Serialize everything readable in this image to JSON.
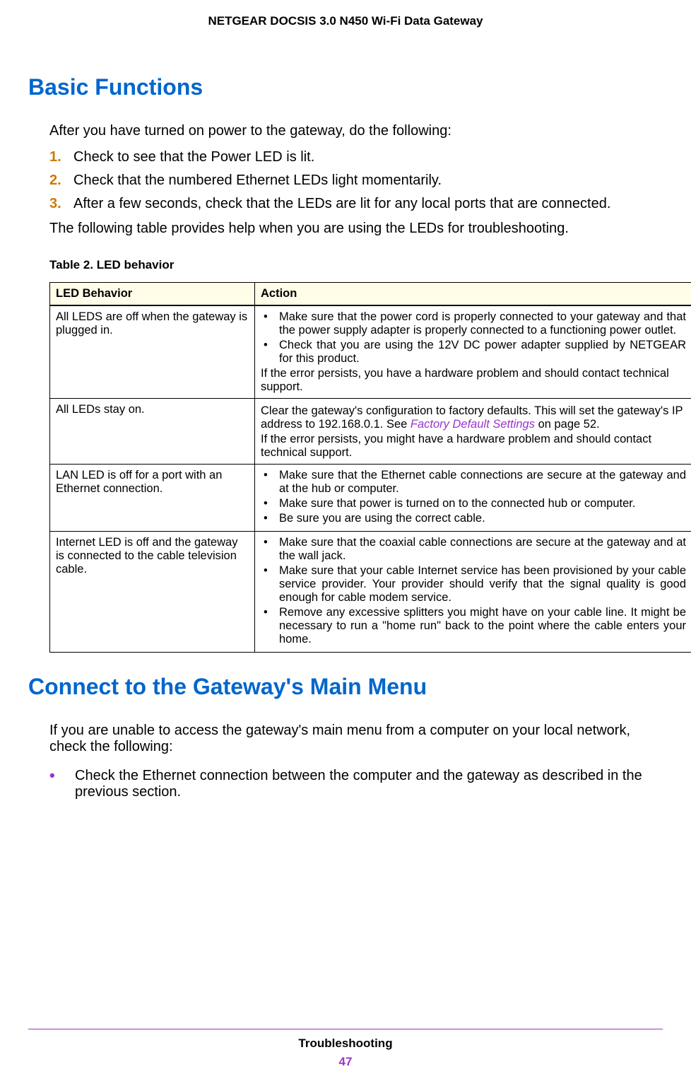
{
  "header": "NETGEAR DOCSIS 3.0 N450 Wi-Fi Data Gateway",
  "section1": {
    "heading": "Basic Functions",
    "intro": "After you have turned on power to the gateway, do the following:",
    "steps": [
      "Check to see that the Power LED is lit.",
      "Check that the numbered Ethernet LEDs light momentarily.",
      "After a few seconds, check that the LEDs are lit for any local ports that are connected."
    ],
    "after_steps": "The following table provides help when you are using the LEDs for troubleshooting."
  },
  "table": {
    "caption": "Table 2.  LED behavior",
    "headers": [
      "LED Behavior",
      "Action"
    ],
    "rows": [
      {
        "behavior": "All LEDS are off when the gateway is plugged in.",
        "bullets": [
          "Make sure that the power cord is properly connected to your gateway and that the power supply adapter is properly connected to a functioning power outlet.",
          "Check that you are using the 12V DC power adapter supplied by NETGEAR for this product."
        ],
        "trailing": "If the error persists, you have a hardware problem and should contact technical support."
      },
      {
        "behavior": "All LEDs stay on.",
        "para_parts": {
          "pre": "Clear the gateway's configuration to factory defaults. This will set the gateway's IP address to 192.168.0.1. See ",
          "link": "Factory Default Settings",
          "post": " on page 52."
        },
        "trailing": "If the error persists, you might have a hardware problem and should contact technical support."
      },
      {
        "behavior": "LAN LED is off for a port with an Ethernet connection.",
        "bullets": [
          "Make sure that the Ethernet cable connections are secure at the gateway and at the hub or computer.",
          "Make sure that power is turned on to the connected hub or computer.",
          "Be sure you are using the correct cable."
        ]
      },
      {
        "behavior": "Internet LED is off and the gateway is connected to the cable television cable.",
        "bullets": [
          "Make sure that the coaxial cable connections are secure at the gateway and at the wall jack.",
          "Make sure that your cable Internet service has been provisioned by your cable service provider. Your provider should verify that the signal quality is good enough for cable modem service.",
          "Remove any excessive splitters you might have on your cable line. It might be necessary to run a \"home run\" back to the point where the cable enters your home."
        ]
      }
    ]
  },
  "section2": {
    "heading": "Connect to the Gateway's Main Menu",
    "para": "If you are unable to access the gateway's main menu from a computer on your local network, check the following:",
    "bullet": "Check the Ethernet connection between the computer and the gateway as described in the previous section."
  },
  "footer": {
    "section": "Troubleshooting",
    "page": "47"
  }
}
